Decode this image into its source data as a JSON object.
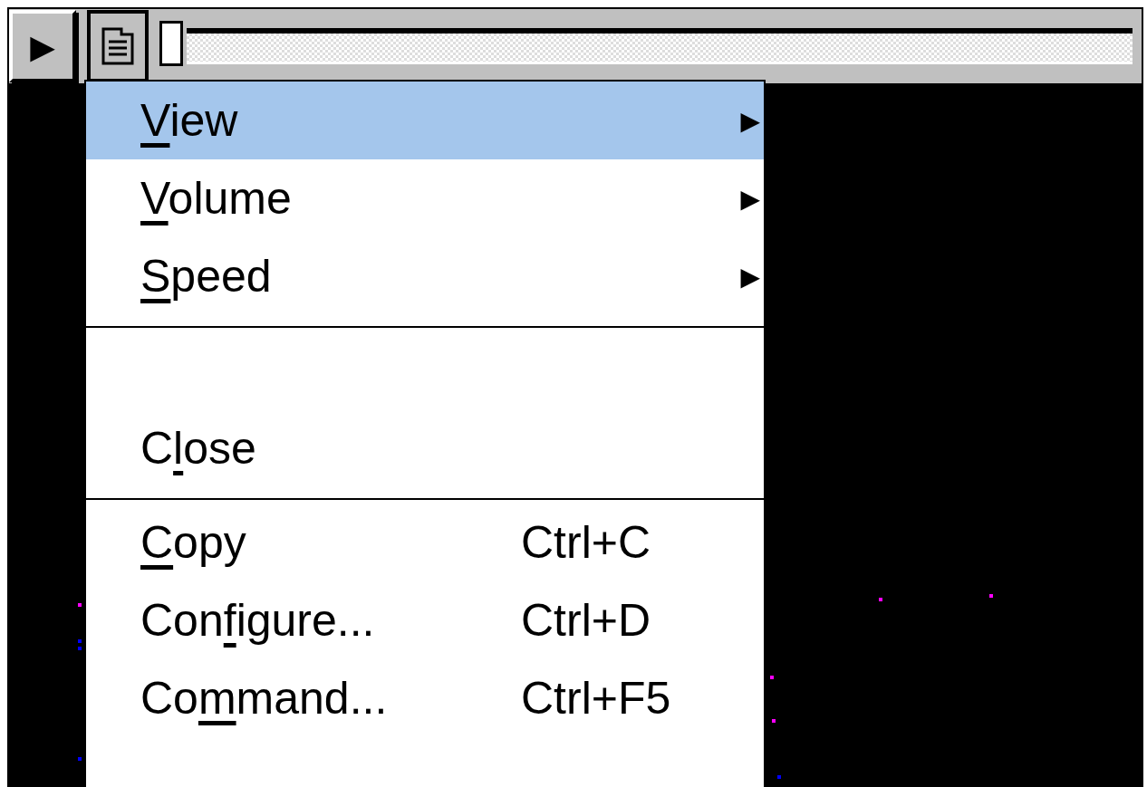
{
  "toolbar": {
    "play_button": {
      "label": "▶"
    },
    "menu_button": {
      "selected": true
    },
    "seek_slider": {
      "level": 0
    }
  },
  "menu": {
    "items": [
      {
        "kind": "submenu",
        "label": {
          "key": "V",
          "after": "iew"
        },
        "selected": true,
        "arrow": "▶"
      },
      {
        "kind": "submenu",
        "label": {
          "key": "V",
          "after": "olume"
        },
        "selected": false,
        "arrow": "▶"
      },
      {
        "kind": "submenu",
        "label": {
          "key": "S",
          "after": "peed"
        },
        "selected": false,
        "arrow": "▶"
      },
      {
        "kind": "separator"
      },
      {
        "kind": "blank"
      },
      {
        "kind": "item",
        "label": {
          "before": "C",
          "key": "l",
          "after": "ose"
        },
        "selected": false
      },
      {
        "kind": "separator"
      },
      {
        "kind": "item",
        "label": {
          "key": "C",
          "after": "opy"
        },
        "shortcut": "Ctrl+C",
        "selected": false
      },
      {
        "kind": "item",
        "label": {
          "before": "Con",
          "key": "f",
          "after": "igure..."
        },
        "shortcut": "Ctrl+D",
        "selected": false
      },
      {
        "kind": "item",
        "label": {
          "before": "Co",
          "key": "m",
          "after": "mand..."
        },
        "shortcut": "Ctrl+F5",
        "selected": false
      }
    ]
  }
}
